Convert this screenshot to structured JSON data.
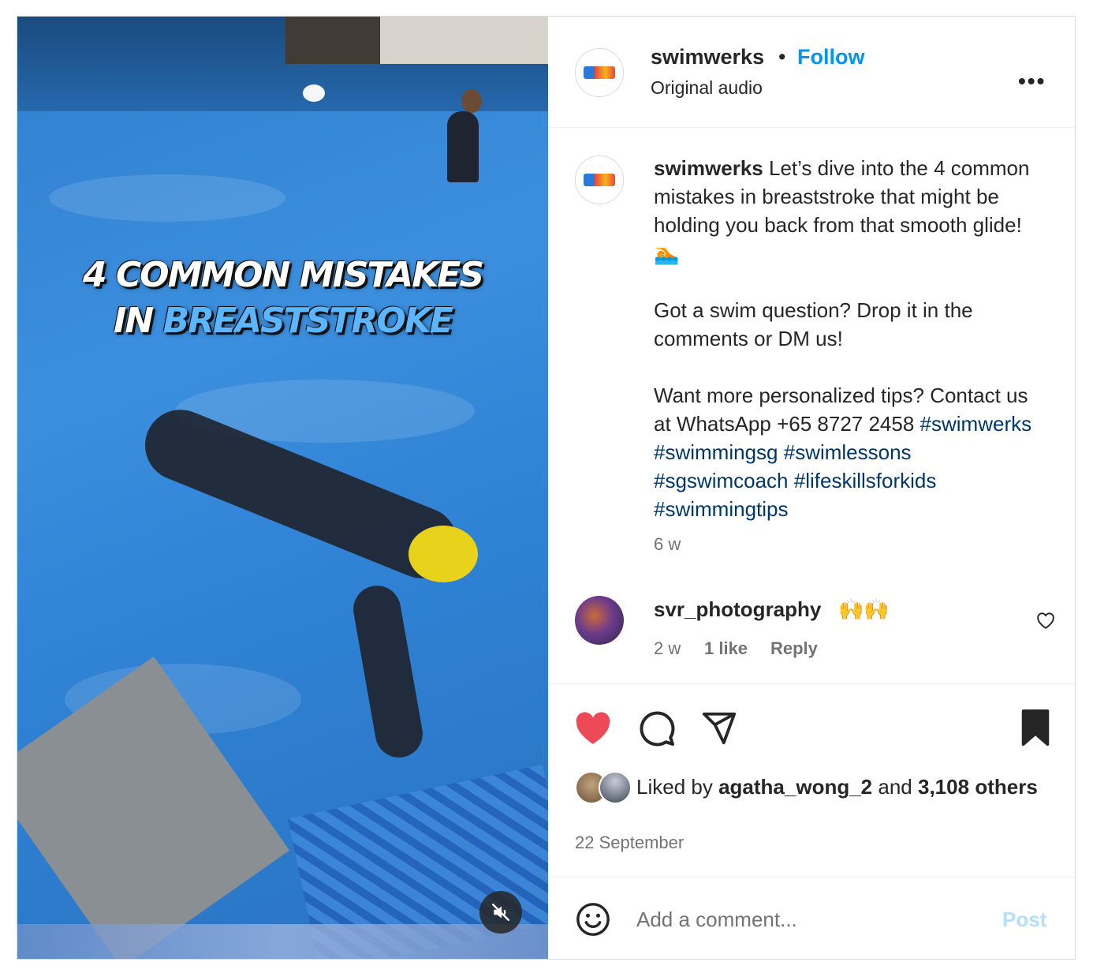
{
  "media": {
    "overlay_line1": "4 COMMON MISTAKES",
    "overlay_line2_a": "IN ",
    "overlay_line2_b": "BREASTSTROKE"
  },
  "header": {
    "username": "swimwerks",
    "separator": "•",
    "follow_label": "Follow",
    "audio": "Original audio",
    "more_label": "•••"
  },
  "caption": {
    "username": "swimwerks",
    "para1": "Let’s dive into the 4 common mistakes in breaststroke that might be holding you back from that smooth glide! 🏊",
    "para2": "Got a swim question? Drop it in the comments or DM us!",
    "para3": "Want more personalized tips? Contact us at WhatsApp +65 8727 2458",
    "hashtags": [
      "#swimwerks",
      "#swimmingsg",
      "#swimlessons",
      "#sgswimcoach",
      "#lifeskillsforkids",
      "#swimmingtips"
    ],
    "time": "6 w"
  },
  "comment": {
    "username": "svr_photography",
    "text": "🙌🙌",
    "time": "2 w",
    "likes": "1 like",
    "reply": "Reply"
  },
  "likes": {
    "prefix": "Liked by",
    "user": "agatha_wong_2",
    "and": "and",
    "count": "3,108",
    "others": "others"
  },
  "date": "22 September",
  "comment_input": {
    "placeholder": "Add a comment...",
    "post_label": "Post"
  },
  "colors": {
    "follow": "#0095f6",
    "like_active": "#ed4956",
    "hashtag": "#00376b",
    "post_disabled": "#b2dffc"
  },
  "icons": [
    "like-heart-icon",
    "comment-icon",
    "share-icon",
    "bookmark-icon",
    "emoji-icon",
    "mute-icon",
    "more-icon",
    "comment-heart-icon"
  ]
}
